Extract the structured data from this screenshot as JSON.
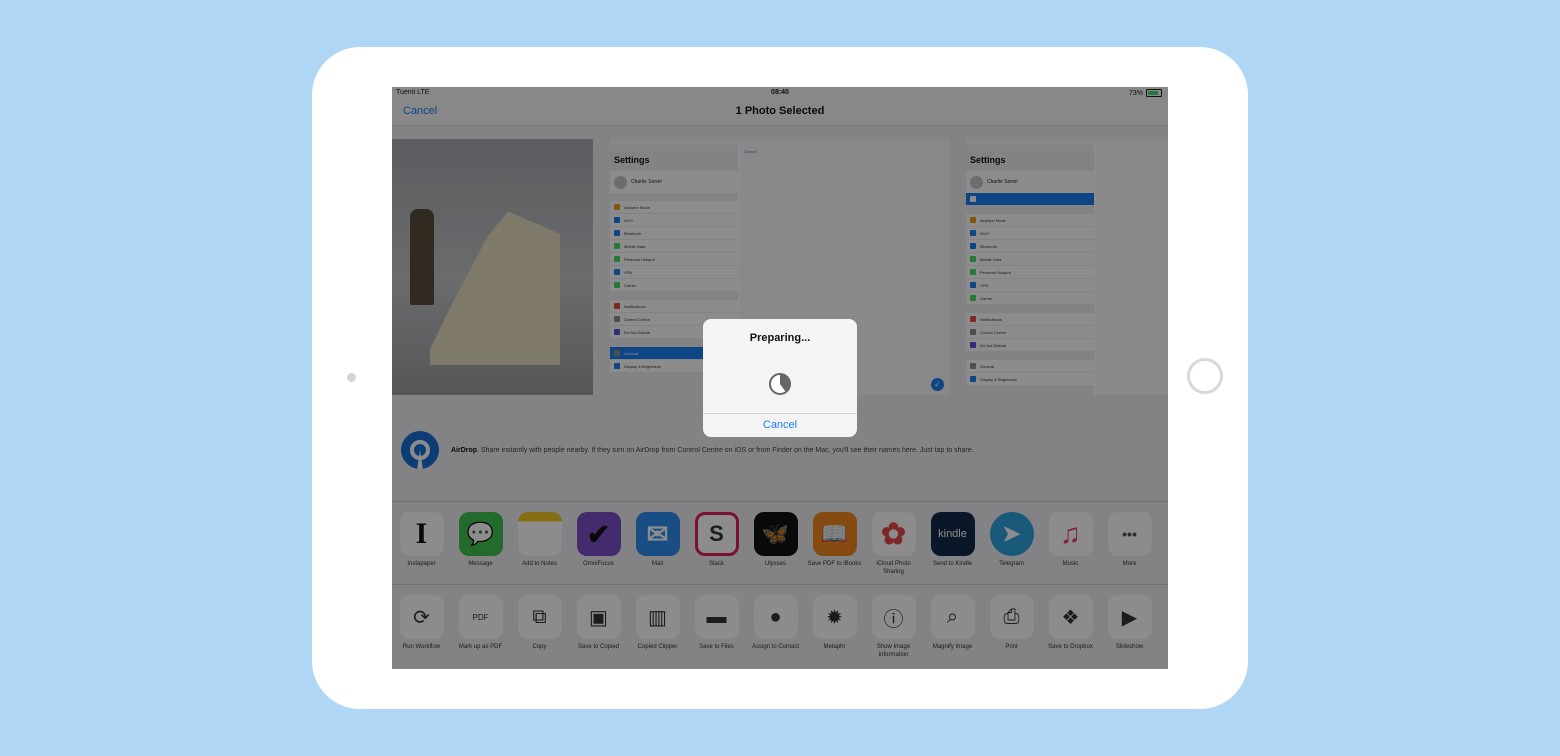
{
  "status_bar": {
    "carrier": "Tuenti  LTE",
    "time": "08:40",
    "battery": "73%"
  },
  "nav": {
    "cancel": "Cancel",
    "title": "1 Photo Selected"
  },
  "photos": {
    "photo1_caption": "",
    "settings_title": "Settings",
    "profile_name": "Charlie Sorrel",
    "settings_rows": [
      "Airplane Mode",
      "Wi-Fi",
      "Bluetooth",
      "Mobile Data",
      "Personal Hotspot",
      "VPN",
      "Carrier",
      "Notifications",
      "Control Centre",
      "Do Not Disturb",
      "General",
      "Display & Brightness"
    ],
    "left_nav_cancel": "Cancel"
  },
  "airdrop": {
    "title": "AirDrop",
    "text": ". Share instantly with people nearby. If they turn on AirDrop from Control Centre on iOS or from Finder on the Mac, you'll see their names here. Just tap to share."
  },
  "apps": [
    {
      "label": "Instapaper",
      "glyph": "I",
      "bg": "#ffffff",
      "fg": "#111111"
    },
    {
      "label": "Message",
      "glyph": "💬",
      "bg": "#3fc353",
      "fg": "#ffffff"
    },
    {
      "label": "Add to Notes",
      "glyph": "",
      "bg": "#ffffff",
      "fg": "#e8c23a"
    },
    {
      "label": "OmniFocus",
      "glyph": "✔",
      "bg": "#7b4fc9",
      "fg": "#111111"
    },
    {
      "label": "Mail",
      "glyph": "✉",
      "bg": "#2f8ef0",
      "fg": "#ffffff"
    },
    {
      "label": "Slack",
      "glyph": "S",
      "bg": "#ffffff",
      "fg": "#333333"
    },
    {
      "label": "Ulysses",
      "glyph": "🦋",
      "bg": "#111111",
      "fg": "#f3c623"
    },
    {
      "label": "Save PDF to iBooks",
      "glyph": "📖",
      "bg": "#f3891f",
      "fg": "#ffffff"
    },
    {
      "label": "iCloud Photo Sharing",
      "glyph": "✿",
      "bg": "#ffffff",
      "fg": "#e34a4a"
    },
    {
      "label": "Send to Kindle",
      "glyph": "kindle",
      "bg": "#122a4a",
      "fg": "#ffffff"
    },
    {
      "label": "Telegram",
      "glyph": "➤",
      "bg": "#2fa5e0",
      "fg": "#ffffff"
    },
    {
      "label": "Music",
      "glyph": "♫",
      "bg": "#ffffff",
      "fg": "#e8436a"
    },
    {
      "label": "More",
      "glyph": "•••",
      "bg": "#ffffff",
      "fg": "#555555"
    }
  ],
  "actions": [
    {
      "label": "Run Workflow",
      "glyph": "⟳"
    },
    {
      "label": "Mark up as PDF",
      "glyph": "PDF"
    },
    {
      "label": "Copy",
      "glyph": "⧉"
    },
    {
      "label": "Save to Copied",
      "glyph": "▣"
    },
    {
      "label": "Copied Clipper",
      "glyph": "▥"
    },
    {
      "label": "Save to Files",
      "glyph": "▬"
    },
    {
      "label": "Assign to Contact",
      "glyph": "●"
    },
    {
      "label": "Metaphr",
      "glyph": "✹"
    },
    {
      "label": "Show Image Information",
      "glyph": "ⓘ"
    },
    {
      "label": "Magnify Image",
      "glyph": "⌕"
    },
    {
      "label": "Print",
      "glyph": "⎙"
    },
    {
      "label": "Save to Dropbox",
      "glyph": "❖"
    },
    {
      "label": "Slideshow",
      "glyph": "▶"
    }
  ],
  "alert": {
    "title": "Preparing...",
    "cancel": "Cancel"
  }
}
